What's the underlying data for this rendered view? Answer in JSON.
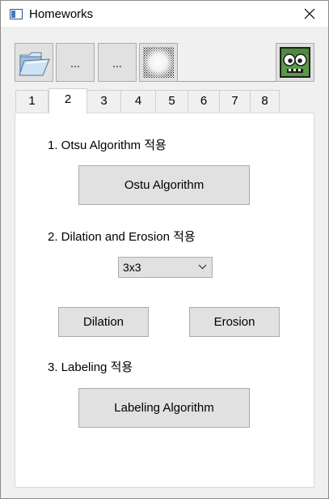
{
  "window": {
    "title": "Homeworks",
    "icon": "window-app-icon",
    "close_icon": "close-icon"
  },
  "toolbar": {
    "buttons": [
      {
        "name": "open-folder",
        "icon": "open-folder-icon",
        "label": ""
      },
      {
        "name": "more-1",
        "icon": "",
        "label": "..."
      },
      {
        "name": "more-2",
        "icon": "",
        "label": "..."
      },
      {
        "name": "noise-image",
        "icon": "noise-image-icon",
        "label": ""
      },
      {
        "name": "monster",
        "icon": "monster-face-icon",
        "label": ""
      }
    ]
  },
  "tabs": {
    "items": [
      "1",
      "2",
      "3",
      "4",
      "5",
      "6",
      "7",
      "8"
    ],
    "active": "2"
  },
  "main": {
    "section1_label": "1. Otsu Algorithm 적용",
    "otsu_button": "Ostu Algorithm",
    "section2_label": "2. Dilation and Erosion 적용",
    "kernel_select": {
      "value": "3x3",
      "icon": "chevron-down-icon"
    },
    "dilation_button": "Dilation",
    "erosion_button": "Erosion",
    "section3_label": "3. Labeling 적용",
    "labeling_button": "Labeling Algorithm"
  },
  "colors": {
    "button_face": "#e1e1e1",
    "button_border": "#adadad",
    "panel_bg": "#ffffff",
    "window_bg": "#f0f0f0",
    "monster_green": "#4c8a3c"
  }
}
